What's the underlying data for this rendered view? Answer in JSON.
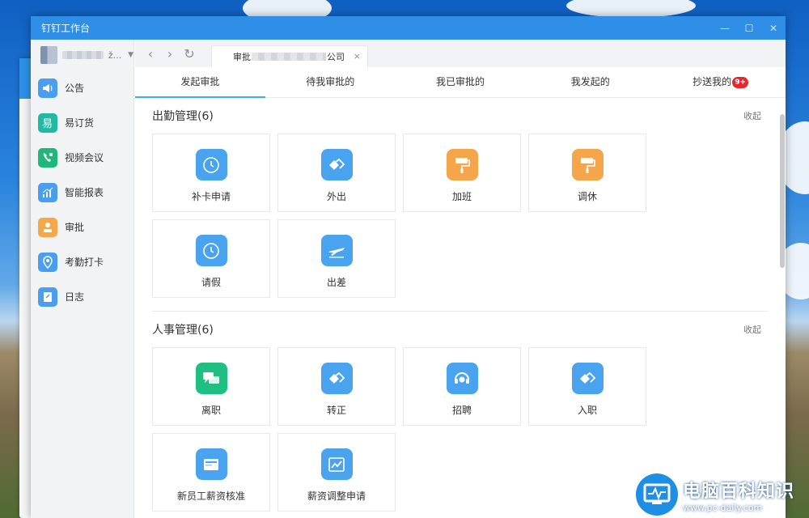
{
  "window": {
    "title": "钉钉工作台",
    "min": "—",
    "max": "☐",
    "close": "✕"
  },
  "profile": {
    "suffix": "ž..."
  },
  "sidebar": {
    "items": [
      {
        "label": "公告",
        "icon": "megaphone-icon",
        "color": "#4a9ef0"
      },
      {
        "label": "易订货",
        "icon": "yidinghuo-icon",
        "color": "#20b9a5"
      },
      {
        "label": "视频会议",
        "icon": "video-call-icon",
        "color": "#1fb77c"
      },
      {
        "label": "智能报表",
        "icon": "chart-icon",
        "color": "#4a9ef0"
      },
      {
        "label": "审批",
        "icon": "approval-icon",
        "color": "#f5a84a"
      },
      {
        "label": "考勤打卡",
        "icon": "location-icon",
        "color": "#4a9ef0"
      },
      {
        "label": "日志",
        "icon": "log-icon",
        "color": "#4a9ef0"
      }
    ]
  },
  "browser": {
    "back": "‹",
    "forward": "›",
    "refresh": "↻",
    "tab_prefix": "审批",
    "tab_suffix": "公司",
    "tab_close": "×"
  },
  "tabs": [
    {
      "label": "发起审批",
      "active": true
    },
    {
      "label": "待我审批的",
      "active": false
    },
    {
      "label": "我已审批的",
      "active": false
    },
    {
      "label": "我发起的",
      "active": false
    },
    {
      "label": "抄送我的",
      "active": false,
      "badge": "9+"
    }
  ],
  "sections": [
    {
      "title": "出勤管理(6)",
      "collapse": "收起",
      "items": [
        {
          "label": "补卡申请",
          "icon": "clock-icon",
          "color": "#4aa3ef"
        },
        {
          "label": "外出",
          "icon": "handshake-icon",
          "color": "#4aa3ef"
        },
        {
          "label": "加班",
          "icon": "paint-roller-icon",
          "color": "#f5a54a"
        },
        {
          "label": "调休",
          "icon": "paint-roller-icon",
          "color": "#f5a54a"
        },
        {
          "label": "请假",
          "icon": "clock-icon",
          "color": "#4aa3ef"
        },
        {
          "label": "出差",
          "icon": "airplane-icon",
          "color": "#4aa3ef"
        }
      ]
    },
    {
      "title": "人事管理(6)",
      "collapse": "收起",
      "items": [
        {
          "label": "离职",
          "icon": "chat-bubbles-icon",
          "color": "#1fbf84"
        },
        {
          "label": "转正",
          "icon": "handshake-icon",
          "color": "#4aa3ef"
        },
        {
          "label": "招聘",
          "icon": "headset-icon",
          "color": "#4aa3ef"
        },
        {
          "label": "入职",
          "icon": "handshake-icon",
          "color": "#4aa3ef"
        },
        {
          "label": "新员工薪资核准",
          "icon": "salary-card-icon",
          "color": "#4aa3ef"
        },
        {
          "label": "薪资调整申请",
          "icon": "trend-chart-icon",
          "color": "#4aa3ef"
        }
      ]
    }
  ],
  "watermark": {
    "title": "电脑百科知识",
    "url": "www.pc-daily.com"
  }
}
